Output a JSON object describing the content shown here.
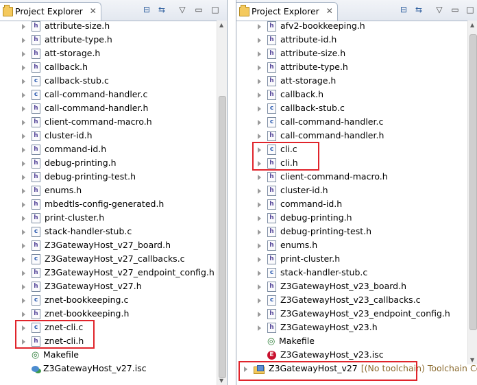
{
  "left": {
    "tab_label": "Project Explorer",
    "tab_close": "✕",
    "items": [
      {
        "name": "attribute-size.h",
        "type": "h"
      },
      {
        "name": "attribute-type.h",
        "type": "h"
      },
      {
        "name": "att-storage.h",
        "type": "h"
      },
      {
        "name": "callback.h",
        "type": "h"
      },
      {
        "name": "callback-stub.c",
        "type": "c"
      },
      {
        "name": "call-command-handler.c",
        "type": "c"
      },
      {
        "name": "call-command-handler.h",
        "type": "h"
      },
      {
        "name": "client-command-macro.h",
        "type": "h"
      },
      {
        "name": "cluster-id.h",
        "type": "h"
      },
      {
        "name": "command-id.h",
        "type": "h"
      },
      {
        "name": "debug-printing.h",
        "type": "h"
      },
      {
        "name": "debug-printing-test.h",
        "type": "h"
      },
      {
        "name": "enums.h",
        "type": "h"
      },
      {
        "name": "mbedtls-config-generated.h",
        "type": "h"
      },
      {
        "name": "print-cluster.h",
        "type": "h"
      },
      {
        "name": "stack-handler-stub.c",
        "type": "c"
      },
      {
        "name": "Z3GatewayHost_v27_board.h",
        "type": "h"
      },
      {
        "name": "Z3GatewayHost_v27_callbacks.c",
        "type": "c"
      },
      {
        "name": "Z3GatewayHost_v27_endpoint_config.h",
        "type": "h"
      },
      {
        "name": "Z3GatewayHost_v27.h",
        "type": "h"
      },
      {
        "name": "znet-bookkeeping.c",
        "type": "c"
      },
      {
        "name": "znet-bookkeeping.h",
        "type": "h"
      },
      {
        "name": "znet-cli.c",
        "type": "c"
      },
      {
        "name": "znet-cli.h",
        "type": "h"
      },
      {
        "name": "Makefile",
        "type": "mk"
      },
      {
        "name": "Z3GatewayHost_v27.isc",
        "type": "isc"
      }
    ]
  },
  "right": {
    "tab_label": "Project Explorer",
    "tab_close": "✕",
    "items": [
      {
        "name": "afv2-bookkeeping.h",
        "type": "h"
      },
      {
        "name": "attribute-id.h",
        "type": "h"
      },
      {
        "name": "attribute-size.h",
        "type": "h"
      },
      {
        "name": "attribute-type.h",
        "type": "h"
      },
      {
        "name": "att-storage.h",
        "type": "h"
      },
      {
        "name": "callback.h",
        "type": "h"
      },
      {
        "name": "callback-stub.c",
        "type": "c"
      },
      {
        "name": "call-command-handler.c",
        "type": "c"
      },
      {
        "name": "call-command-handler.h",
        "type": "h"
      },
      {
        "name": "cli.c",
        "type": "c"
      },
      {
        "name": "cli.h",
        "type": "h"
      },
      {
        "name": "client-command-macro.h",
        "type": "h"
      },
      {
        "name": "cluster-id.h",
        "type": "h"
      },
      {
        "name": "command-id.h",
        "type": "h"
      },
      {
        "name": "debug-printing.h",
        "type": "h"
      },
      {
        "name": "debug-printing-test.h",
        "type": "h"
      },
      {
        "name": "enums.h",
        "type": "h"
      },
      {
        "name": "print-cluster.h",
        "type": "h"
      },
      {
        "name": "stack-handler-stub.c",
        "type": "c"
      },
      {
        "name": "Z3GatewayHost_v23_board.h",
        "type": "h"
      },
      {
        "name": "Z3GatewayHost_v23_callbacks.c",
        "type": "c"
      },
      {
        "name": "Z3GatewayHost_v23_endpoint_config.h",
        "type": "h"
      },
      {
        "name": "Z3GatewayHost_v23.h",
        "type": "h"
      },
      {
        "name": "Makefile",
        "type": "mk"
      },
      {
        "name": "Z3GatewayHost_v23.isc",
        "type": "err"
      }
    ],
    "project": {
      "name": "Z3GatewayHost_v27",
      "decoration": "[(No toolchain) Toolchain Cor"
    }
  }
}
